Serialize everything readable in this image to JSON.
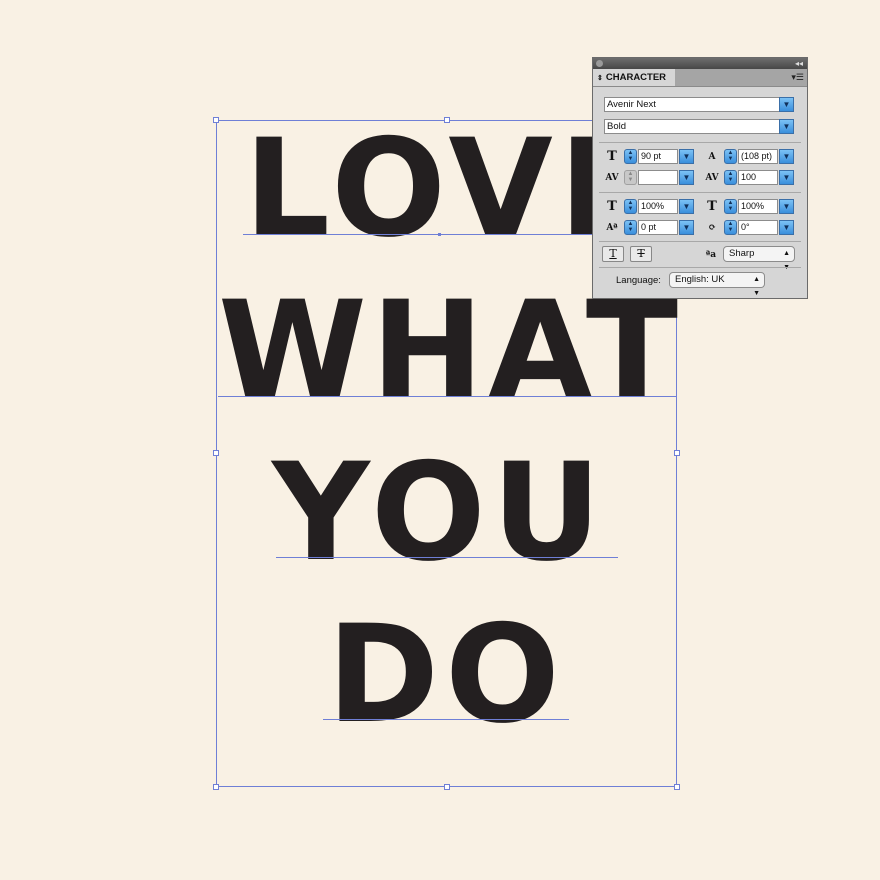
{
  "artwork": {
    "lines": [
      "LOVE",
      "WHAT",
      "YOU",
      "DO"
    ],
    "text_color": "#231f20",
    "selection_color": "#6f7fd6",
    "background": "#f9f1e4"
  },
  "panel": {
    "tab_label": "CHARACTER",
    "tab_arrows": "⇕",
    "collapse_glyph": "◂◂",
    "menu_glyph": "▾☰",
    "font_family": "Avenir Next",
    "font_style": "Bold",
    "font_size": "90 pt",
    "leading": "(108 pt)",
    "kerning": "",
    "tracking": "100",
    "vertical_scale": "100%",
    "horizontal_scale": "100%",
    "baseline_shift": "0 pt",
    "character_rotation": "0°",
    "antialias": "Sharp",
    "language_label": "Language:",
    "language": "English: UK",
    "antialias_icon_text": "ªa",
    "underline_icon_text": "T",
    "strikethrough_icon_text": "T"
  }
}
